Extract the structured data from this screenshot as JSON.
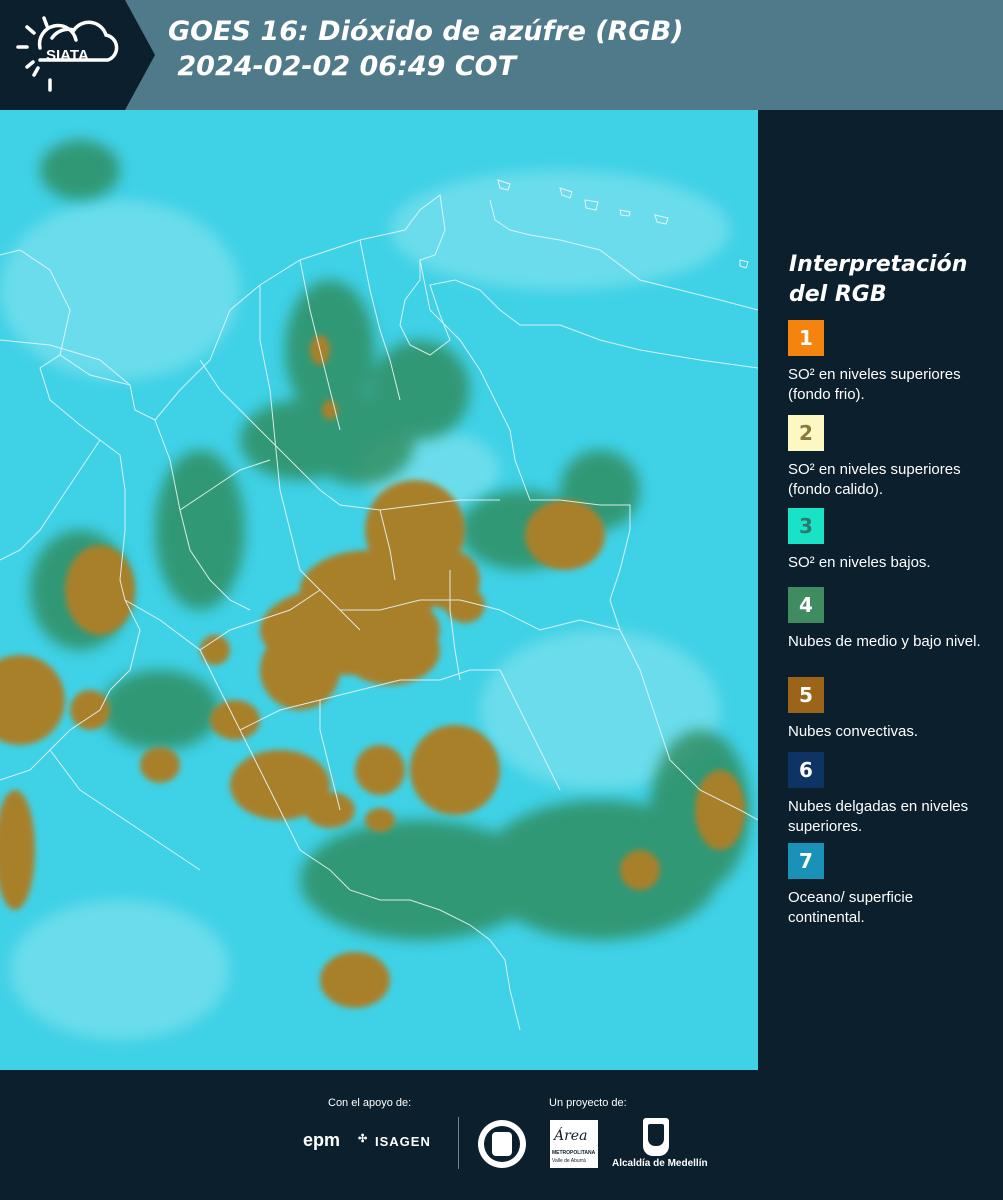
{
  "header": {
    "logo_text": "SIATA",
    "title": "GOES 16: Dióxido de azúfre (RGB)\n 2024-02-02 06:49 COT"
  },
  "legend": {
    "title": "Interpretación del RGB",
    "items": [
      {
        "number": "1",
        "color": "#f5840e",
        "number_color": "#ffffff",
        "text": "SO² en niveles superiores (fondo frio)."
      },
      {
        "number": "2",
        "color": "#fdf7c3",
        "number_color": "#8a7a3a",
        "text": "SO² en niveles superiores (fondo calido)."
      },
      {
        "number": "3",
        "color": "#19e3c7",
        "number_color": "#2a7a70",
        "text": "SO² en niveles bajos."
      },
      {
        "number": "4",
        "color": "#3e8c5f",
        "number_color": "#ffffff",
        "text": "Nubes de medio y bajo nivel."
      },
      {
        "number": "5",
        "color": "#9b6418",
        "number_color": "#ffffff",
        "text": "Nubes convectivas."
      },
      {
        "number": "6",
        "color": "#0e3466",
        "number_color": "#ffffff",
        "text": "Nubes delgadas en niveles superiores."
      },
      {
        "number": "7",
        "color": "#1a92b8",
        "number_color": "#ffffff",
        "text": "Oceano/ superficie continental."
      }
    ]
  },
  "footer": {
    "support_label": "Con el apoyo de:",
    "project_label": "Un proyecto de:",
    "epm": "epm",
    "isagen": "ISAGEN",
    "area_name": "Área",
    "area_sub": "METROPOLITANA",
    "area_sub2": "Valle de Aburrá",
    "alcaldia": "Alcaldía de Medellín"
  },
  "map_colors": {
    "background": "#3fd1e6",
    "convective": "#a8802c",
    "low_cloud": "#2f8a5a",
    "thin_cloud": "#1e6e72",
    "border": "#e8f4f8"
  }
}
